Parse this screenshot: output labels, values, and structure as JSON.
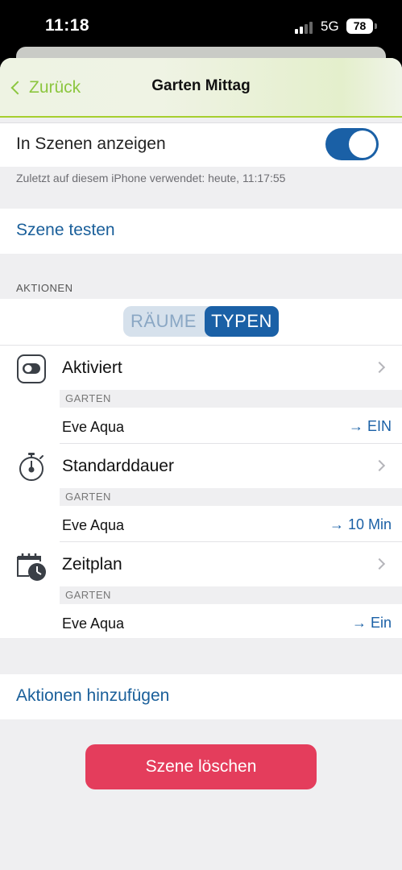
{
  "status_bar": {
    "time": "11:18",
    "network": "5G",
    "battery": "78"
  },
  "nav": {
    "back_label": "Zurück",
    "title": "Garten Mittag"
  },
  "show_in_scenes": {
    "label": "In Szenen anzeigen",
    "enabled": true
  },
  "last_used": "Zuletzt auf diesem iPhone verwendet: heute, 11:17:55",
  "test_scene": "Szene testen",
  "actions": {
    "header": "AKTIONEN",
    "segments": {
      "rooms": "RÄUME",
      "types": "TYPEN",
      "selected": "TYPEN"
    },
    "groups": [
      {
        "title": "Aktiviert",
        "icon": "toggle-icon",
        "room": "GARTEN",
        "device": "Eve Aqua",
        "value": "→ EIN"
      },
      {
        "title": "Standarddauer",
        "icon": "stopwatch-icon",
        "room": "GARTEN",
        "device": "Eve Aqua",
        "value": "→ 10 Min"
      },
      {
        "title": "Zeitplan",
        "icon": "calendar-clock-icon",
        "room": "GARTEN",
        "device": "Eve Aqua",
        "value": "→ Ein"
      }
    ]
  },
  "add_actions": "Aktionen hinzufügen",
  "delete_scene": "Szene löschen",
  "colors": {
    "accent_blue": "#1a60a6",
    "accent_green": "#8cc63f",
    "delete_red": "#e43d5c"
  }
}
